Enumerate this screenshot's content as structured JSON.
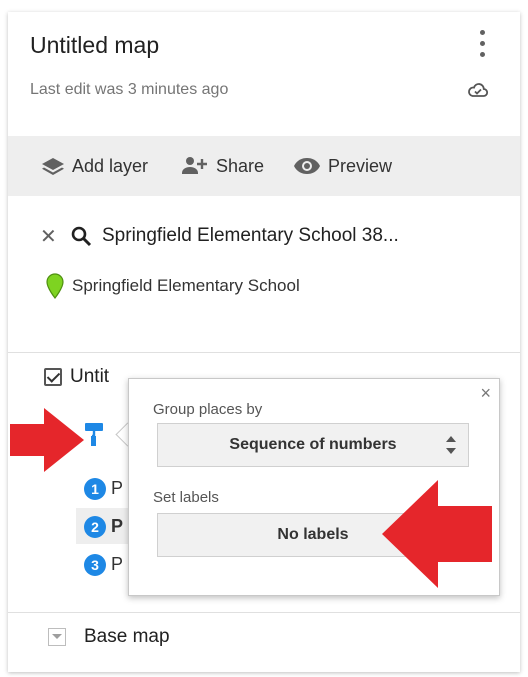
{
  "map": {
    "title": "Untitled map",
    "last_edit": "Last edit was 3 minutes ago"
  },
  "toolbar": {
    "add_layer": "Add layer",
    "share": "Share",
    "preview": "Preview"
  },
  "search": {
    "query": "Springfield Elementary School 38...",
    "result": "Springfield Elementary School"
  },
  "layer": {
    "name": "Untit",
    "places": [
      {
        "number": "1",
        "letter": "P"
      },
      {
        "number": "2",
        "letter": "P"
      },
      {
        "number": "3",
        "letter": "P"
      }
    ]
  },
  "popup": {
    "group_label": "Group places by",
    "group_value": "Sequence of numbers",
    "labels_label": "Set labels",
    "labels_value": "No labels",
    "close": "×"
  },
  "base_map": "Base map",
  "colors": {
    "accent": "#1e88e5",
    "pin": "#7ed321",
    "annotation_arrow": "#e5262b"
  }
}
